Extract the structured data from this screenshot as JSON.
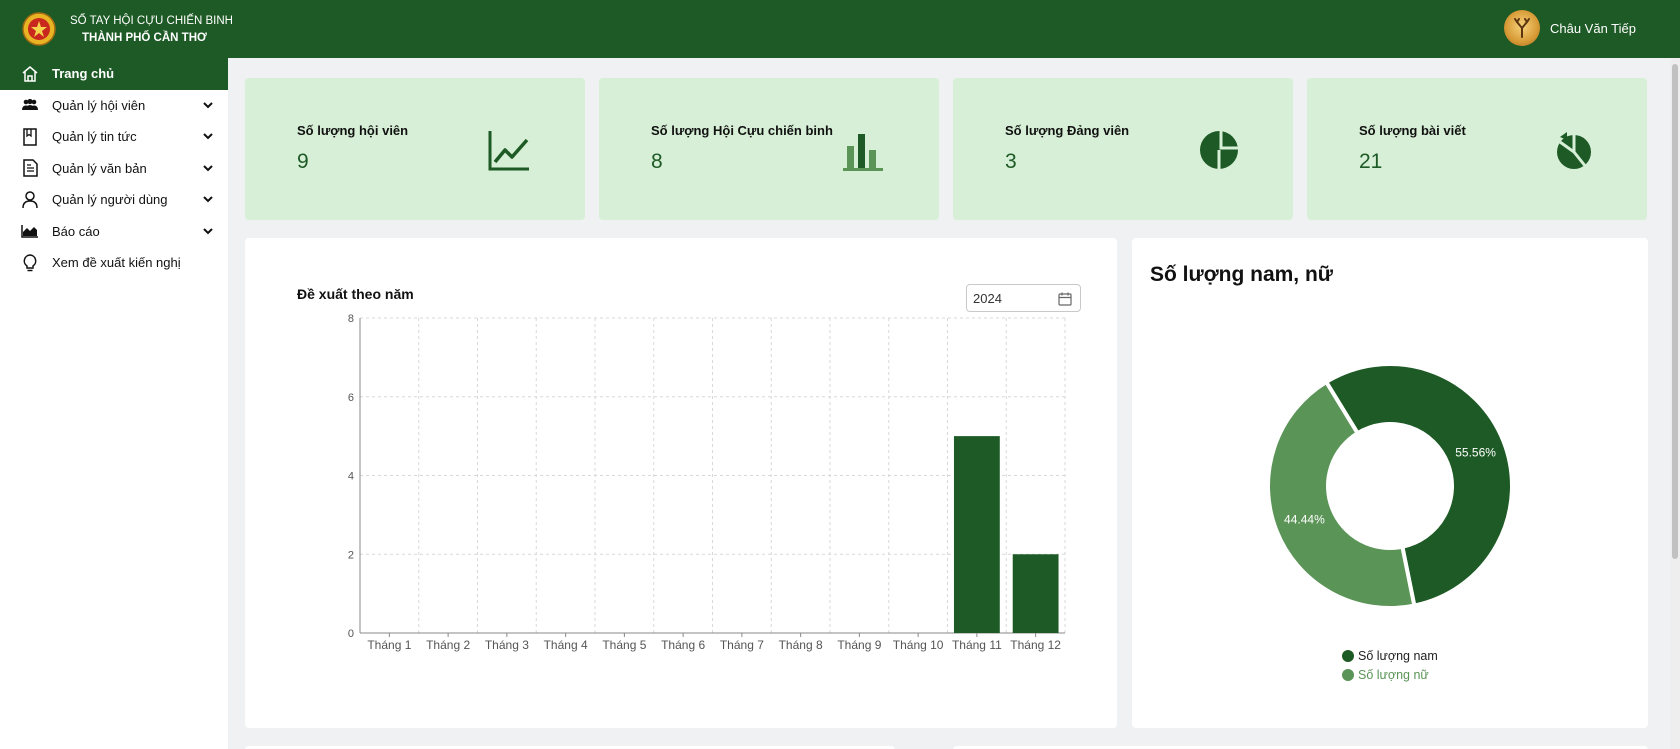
{
  "header": {
    "brand_line1": "SỔ TAY HỘI CỰU CHIẾN BINH",
    "brand_line2": "THÀNH PHỐ CẦN THƠ",
    "user_name": "Châu Văn Tiếp"
  },
  "sidebar": {
    "items": [
      {
        "label": "Trang chủ",
        "icon": "home-icon",
        "active": true
      },
      {
        "label": "Quản lý hội viên",
        "icon": "users-icon"
      },
      {
        "label": "Quản lý tin tức",
        "icon": "bookmark-icon"
      },
      {
        "label": "Quản lý văn bản",
        "icon": "document-icon"
      },
      {
        "label": "Quản lý người dùng",
        "icon": "user-icon"
      },
      {
        "label": "Báo cáo",
        "icon": "area-chart-icon"
      },
      {
        "label": "Xem đề xuất kiến nghị",
        "icon": "lightbulb-icon"
      }
    ]
  },
  "stats": [
    {
      "label": "Số lượng hội viên",
      "value": "9",
      "icon": "line-chart-icon"
    },
    {
      "label": "Số lượng Hội Cựu chiến binh",
      "value": "8",
      "icon": "bar-chart-icon"
    },
    {
      "label": "Số lượng Đảng viên",
      "value": "3",
      "icon": "pie-chart-icon"
    },
    {
      "label": "Số lượng bài viết",
      "value": "21",
      "icon": "pie-chart-alt-icon"
    }
  ],
  "proposal_panel": {
    "title": "Đề xuất theo năm",
    "year_value": "2024"
  },
  "gender_panel": {
    "title": "Số lượng nam, nữ"
  },
  "colors": {
    "primary": "#1d5a25",
    "secondary": "#5b9457",
    "card_bg": "#d6efd6"
  },
  "chart_data": [
    {
      "type": "bar",
      "categories": [
        "Tháng 1",
        "Tháng 2",
        "Tháng 3",
        "Tháng 4",
        "Tháng 5",
        "Tháng 6",
        "Tháng 7",
        "Tháng 8",
        "Tháng 9",
        "Tháng 10",
        "Tháng 11",
        "Tháng 12"
      ],
      "values": [
        0,
        0,
        0,
        0,
        0,
        0,
        0,
        0,
        0,
        0,
        5,
        2
      ],
      "title": "Đề xuất theo năm",
      "ylim": [
        0,
        8
      ],
      "yticks": [
        0,
        2,
        4,
        6,
        8
      ],
      "grid": true
    },
    {
      "type": "pie",
      "title": "Số lượng nam, nữ",
      "donut": true,
      "labels": [
        "Số lượng nam",
        "Số lượng nữ"
      ],
      "values": [
        55.56,
        44.44
      ],
      "value_labels": [
        "55.56%",
        "44.44%"
      ],
      "legend": "bottom"
    }
  ]
}
